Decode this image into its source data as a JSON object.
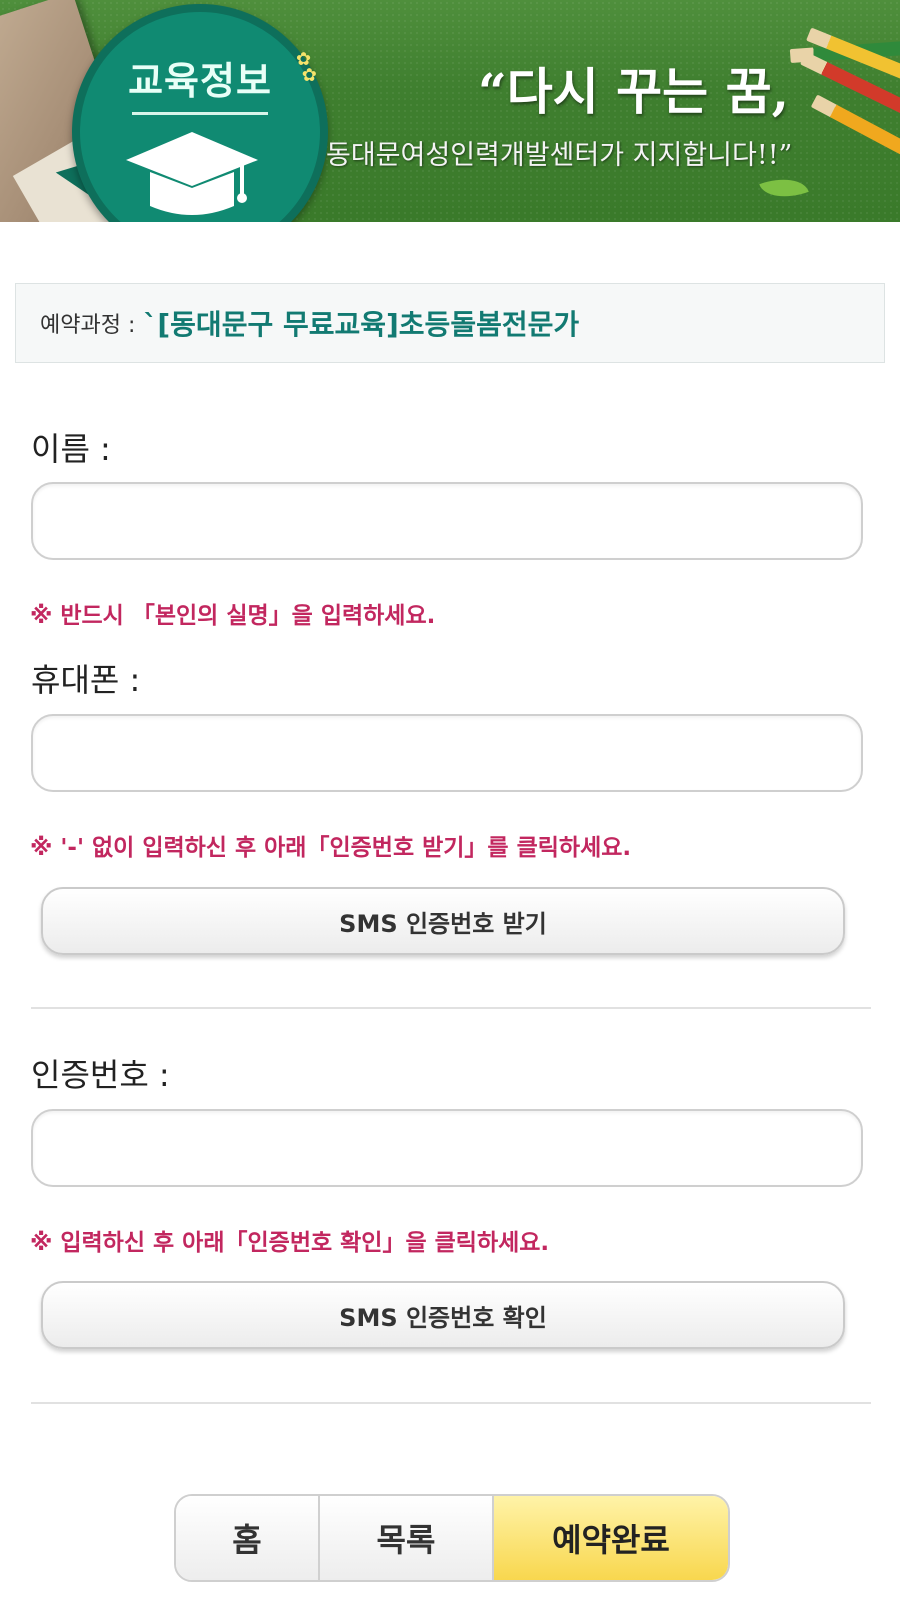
{
  "banner": {
    "badge_title": "교육정보",
    "slogan_main": "“다시 꾸는 꿈,",
    "slogan_sub": "동대문여성인력개발센터가 지지합니다!!”"
  },
  "course": {
    "label": "예약과정 :",
    "value": "`[동대문구 무료교육]초등돌봄전문가"
  },
  "form": {
    "name": {
      "label": "이름 :",
      "value": "",
      "hint": "※ 반드시 「본인의 실명」을 입력하세요."
    },
    "phone": {
      "label": "휴대폰 :",
      "value": "",
      "hint": "※ '-' 없이 입력하신 후 아래「인증번호 받기」를 클릭하세요.",
      "button": "SMS 인증번호 받기"
    },
    "code": {
      "label": "인증번호 :",
      "value": "",
      "hint": "※ 입력하신 후 아래「인증번호 확인」을 클릭하세요.",
      "button": "SMS 인증번호 확인"
    }
  },
  "bottom_nav": {
    "home": "홈",
    "list": "목록",
    "complete": "예약완료"
  },
  "colors": {
    "accent_teal": "#127a72",
    "hint_red": "#c2275f",
    "complete_yellow": "#f8d74e",
    "banner_green": "#3f7f2f"
  }
}
